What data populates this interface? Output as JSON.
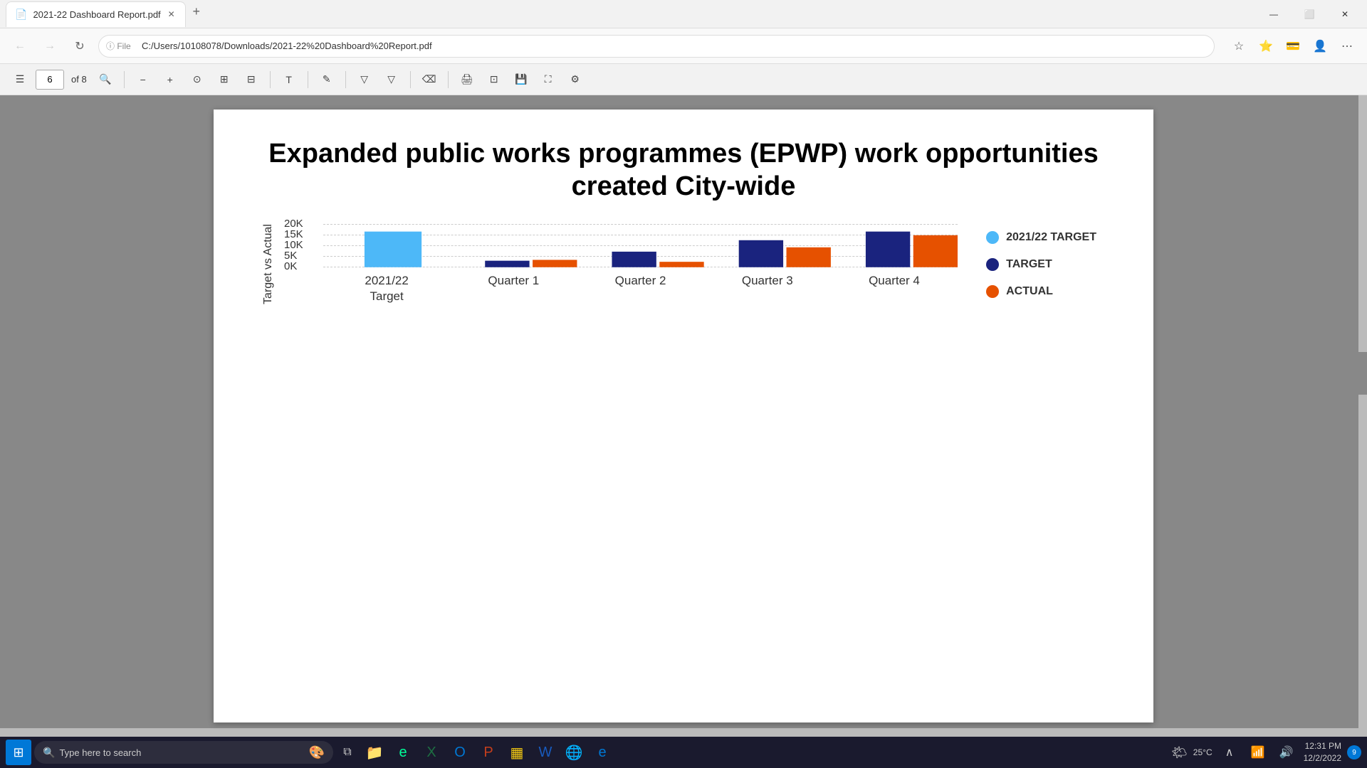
{
  "browser": {
    "tab": {
      "title": "2021-22 Dashboard Report.pdf",
      "icon": "📄"
    },
    "address": "C:/Users/10108078/Downloads/2021-22%20Dashboard%20Report.pdf",
    "address_prefix": "File"
  },
  "pdf": {
    "current_page": "6",
    "total_pages": "of 8",
    "title_line1": "Expanded public works programmes (EPWP) work opportunities",
    "title_line2": "created City-wide"
  },
  "chart": {
    "y_axis_label": "Target vs Actual",
    "y_labels": [
      "20K",
      "15K",
      "10K",
      "5K",
      "0K"
    ],
    "y_values": [
      20000,
      15000,
      10000,
      5000,
      0
    ],
    "groups": [
      {
        "label": "2021/22\nTarget",
        "bars": [
          {
            "series": "target2122",
            "value": 16500,
            "color": "#4db8f8"
          }
        ]
      },
      {
        "label": "Quarter 1",
        "bars": [
          {
            "series": "target",
            "value": 3000,
            "color": "#1a237e"
          },
          {
            "series": "actual",
            "value": 3400,
            "color": "#e65100"
          }
        ]
      },
      {
        "label": "Quarter 2",
        "bars": [
          {
            "series": "target",
            "value": 7200,
            "color": "#1a237e"
          },
          {
            "series": "actual",
            "value": 2500,
            "color": "#e65100"
          }
        ]
      },
      {
        "label": "Quarter 3",
        "bars": [
          {
            "series": "target",
            "value": 12500,
            "color": "#1a237e"
          },
          {
            "series": "actual",
            "value": 9200,
            "color": "#e65100"
          }
        ]
      },
      {
        "label": "Quarter 4",
        "bars": [
          {
            "series": "target",
            "value": 16500,
            "color": "#1a237e"
          },
          {
            "series": "actual",
            "value": 14800,
            "color": "#e65100"
          }
        ]
      }
    ],
    "legend": [
      {
        "label": "2021/22 TARGET",
        "color": "#4db8f8"
      },
      {
        "label": "TARGET",
        "color": "#1a237e"
      },
      {
        "label": "ACTUAL",
        "color": "#e65100"
      }
    ]
  },
  "taskbar": {
    "search_placeholder": "Type here to search",
    "time": "12:31 PM",
    "date": "12/2/2022",
    "temperature": "25°C",
    "notification_count": "9"
  },
  "toolbar": {
    "zoom_label": "Fit Page",
    "page_label": "6"
  }
}
